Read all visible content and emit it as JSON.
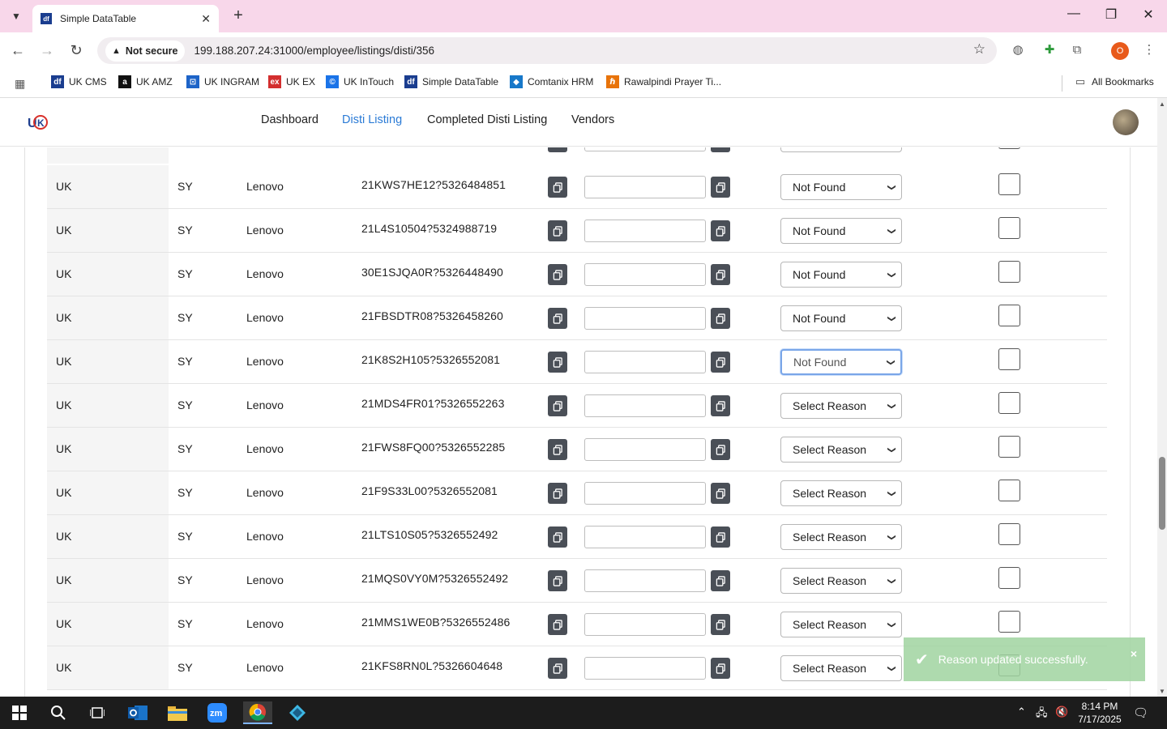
{
  "browser": {
    "tab_title": "Simple DataTable",
    "tab_favicon": "df",
    "not_secure_label": "Not secure",
    "url": "199.188.207.24:31000/employee/listings/disti/356",
    "profile_initial": "O",
    "bookmarks": [
      {
        "label": "UK CMS",
        "icon": "df",
        "color": "#1a3d8f"
      },
      {
        "label": "UK AMZ",
        "icon": "a",
        "color": "#111111"
      },
      {
        "label": "UK INGRAM",
        "icon": "⊡",
        "color": "#1d64c8"
      },
      {
        "label": "UK EX",
        "icon": "ex",
        "color": "#d32f2f"
      },
      {
        "label": "UK InTouch",
        "icon": "©",
        "color": "#1a73e8"
      },
      {
        "label": "Simple DataTable",
        "icon": "df",
        "color": "#1a3d8f"
      },
      {
        "label": "Comtanix HRM",
        "icon": "◆",
        "color": "#1778c9"
      },
      {
        "label": "Rawalpindi Prayer Ti...",
        "icon": "ℏ",
        "color": "#e8730a"
      }
    ],
    "all_bookmarks_label": "All Bookmarks"
  },
  "nav": {
    "links": [
      "Dashboard",
      "Disti Listing",
      "Completed Disti Listing",
      "Vendors"
    ],
    "active": "Disti Listing"
  },
  "table": {
    "rows": [
      {
        "region": "UK",
        "source": "SY",
        "brand": "Lenovo",
        "part": "21KWS7HE12?5326484851",
        "reason": "Not Found"
      },
      {
        "region": "UK",
        "source": "SY",
        "brand": "Lenovo",
        "part": "21L4S10504?5324988719",
        "reason": "Not Found"
      },
      {
        "region": "UK",
        "source": "SY",
        "brand": "Lenovo",
        "part": "30E1SJQA0R?5326448490",
        "reason": "Not Found"
      },
      {
        "region": "UK",
        "source": "SY",
        "brand": "Lenovo",
        "part": "21FBSDTR08?5326458260",
        "reason": "Not Found"
      },
      {
        "region": "UK",
        "source": "SY",
        "brand": "Lenovo",
        "part": "21K8S2H105?5326552081",
        "reason": "Not Found"
      },
      {
        "region": "UK",
        "source": "SY",
        "brand": "Lenovo",
        "part": "21MDS4FR01?5326552263",
        "reason": "Select Reason"
      },
      {
        "region": "UK",
        "source": "SY",
        "brand": "Lenovo",
        "part": "21FWS8FQ00?5326552285",
        "reason": "Select Reason"
      },
      {
        "region": "UK",
        "source": "SY",
        "brand": "Lenovo",
        "part": "21F9S33L00?5326552081",
        "reason": "Select Reason"
      },
      {
        "region": "UK",
        "source": "SY",
        "brand": "Lenovo",
        "part": "21LTS10S05?5326552492",
        "reason": "Select Reason"
      },
      {
        "region": "UK",
        "source": "SY",
        "brand": "Lenovo",
        "part": "21MQS0VY0M?5326552492",
        "reason": "Select Reason"
      },
      {
        "region": "UK",
        "source": "SY",
        "brand": "Lenovo",
        "part": "21MMS1WE0B?5326552486",
        "reason": "Select Reason"
      },
      {
        "region": "UK",
        "source": "SY",
        "brand": "Lenovo",
        "part": "21KFS8RN0L?5326604648",
        "reason": "Select Reason"
      }
    ],
    "focused_row": 4
  },
  "toast": {
    "message": "Reason updated successfully.",
    "close": "×"
  },
  "taskbar": {
    "time": "8:14 PM",
    "date": "7/17/2025"
  }
}
